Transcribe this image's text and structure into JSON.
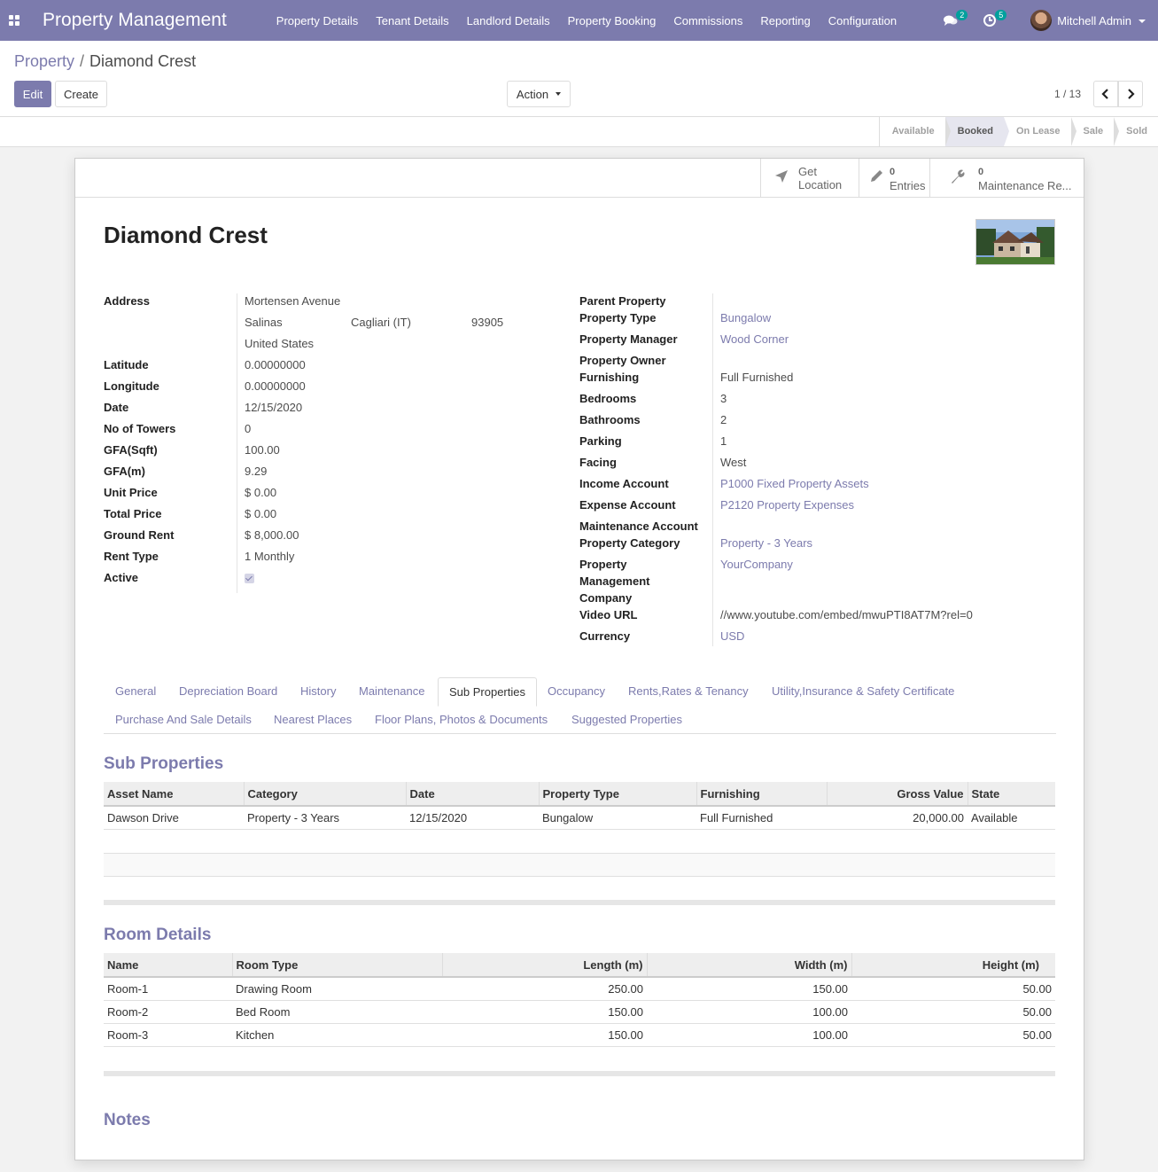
{
  "nav": {
    "brand": "Property Management",
    "menu": [
      "Property Details",
      "Tenant Details",
      "Landlord Details",
      "Property Booking",
      "Commissions",
      "Reporting",
      "Configuration"
    ],
    "messages_count": "2",
    "activities_count": "5",
    "user": "Mitchell Admin"
  },
  "breadcrumb": {
    "parent": "Property",
    "separator": "/",
    "current": "Diamond Crest"
  },
  "toolbar": {
    "edit": "Edit",
    "create": "Create",
    "action": "Action",
    "pager": "1 / 13"
  },
  "status_stages": [
    {
      "label": "Available",
      "active": false
    },
    {
      "label": "Booked",
      "active": true
    },
    {
      "label": "On Lease",
      "active": false
    },
    {
      "label": "Sale",
      "active": false
    },
    {
      "label": "Sold",
      "active": false
    }
  ],
  "smart_buttons": {
    "location": {
      "line1": "Get",
      "line2": "Location"
    },
    "entries": {
      "count": "0",
      "label": "Entries"
    },
    "maintenance": {
      "count": "0",
      "label": "Maintenance Re..."
    }
  },
  "record": {
    "title": "Diamond Crest",
    "left_labels": {
      "address": "Address",
      "latitude": "Latitude",
      "longitude": "Longitude",
      "date": "Date",
      "towers": "No of Towers",
      "gfa_sqft": "GFA(Sqft)",
      "gfa_m": "GFA(m)",
      "unit_price": "Unit Price",
      "total_price": "Total Price",
      "ground_rent": "Ground Rent",
      "rent_type": "Rent Type",
      "active": "Active"
    },
    "address": {
      "street": "Mortensen Avenue",
      "city": "Salinas",
      "state": "Cagliari (IT)",
      "zip": "93905",
      "country": "United States"
    },
    "latitude": "0.00000000",
    "longitude": "0.00000000",
    "date": "12/15/2020",
    "towers": "0",
    "gfa_sqft": "100.00",
    "gfa_m": "9.29",
    "unit_price": "$ 0.00",
    "total_price": "$ 0.00",
    "ground_rent": "$ 8,000.00",
    "rent_type": "1 Monthly",
    "active": true,
    "right_labels": {
      "parent": "Parent Property",
      "ptype": "Property Type",
      "manager": "Property Manager",
      "owner": "Property Owner",
      "furnishing": "Furnishing",
      "bedrooms": "Bedrooms",
      "bathrooms": "Bathrooms",
      "parking": "Parking",
      "facing": "Facing",
      "income": "Income Account",
      "expense": "Expense Account",
      "maintenance": "Maintenance Account",
      "category": "Property Category",
      "company_1": "Property",
      "company_2": "Management",
      "company_3": "Company",
      "video": "Video URL",
      "currency": "Currency"
    },
    "property_type": "Bungalow",
    "property_manager": "Wood Corner",
    "furnishing": "Full Furnished",
    "bedrooms": "3",
    "bathrooms": "2",
    "parking": "1",
    "facing": "West",
    "income_account": "P1000 Fixed Property Assets",
    "expense_account": "P2120 Property Expenses",
    "property_category": "Property - 3 Years",
    "company": "YourCompany",
    "video_url": "//www.youtube.com/embed/mwuPTI8AT7M?rel=0",
    "currency": "USD"
  },
  "tabs": {
    "general": "General",
    "depreciation": "Depreciation Board",
    "history": "History",
    "maintenance": "Maintenance",
    "sub": "Sub Properties",
    "occupancy": "Occupancy",
    "rents": "Rents,Rates & Tenancy",
    "utility": "Utility,Insurance & Safety Certificate",
    "purchase": "Purchase And Sale Details",
    "nearest": "Nearest Places",
    "floor": "Floor Plans, Photos & Documents",
    "suggested": "Suggested Properties"
  },
  "sub_properties": {
    "title": "Sub Properties",
    "headers": {
      "asset": "Asset Name",
      "category": "Category",
      "date": "Date",
      "ptype": "Property Type",
      "furnishing": "Furnishing",
      "gross": "Gross Value",
      "state": "State"
    },
    "rows": [
      {
        "asset": "Dawson Drive",
        "category": "Property - 3 Years",
        "date": "12/15/2020",
        "ptype": "Bungalow",
        "furnishing": "Full Furnished",
        "gross": "20,000.00",
        "state": "Available"
      }
    ]
  },
  "room_details": {
    "title": "Room Details",
    "headers": {
      "name": "Name",
      "type": "Room Type",
      "length": "Length (m)",
      "width": "Width (m)",
      "height": "Height (m)"
    },
    "rows": [
      {
        "name": "Room-1",
        "type": "Drawing Room",
        "length": "250.00",
        "width": "150.00",
        "height": "50.00"
      },
      {
        "name": "Room-2",
        "type": "Bed Room",
        "length": "150.00",
        "width": "100.00",
        "height": "50.00"
      },
      {
        "name": "Room-3",
        "type": "Kitchen",
        "length": "150.00",
        "width": "100.00",
        "height": "50.00"
      }
    ]
  },
  "notes": {
    "title": "Notes"
  }
}
